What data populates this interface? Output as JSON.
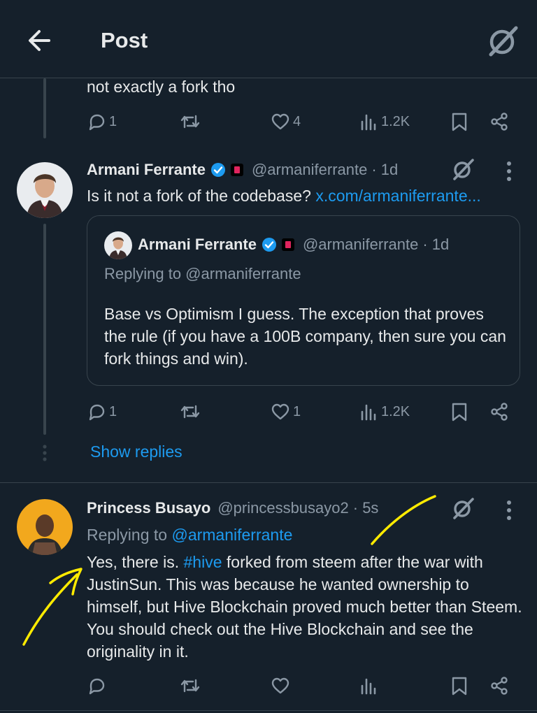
{
  "header": {
    "title": "Post"
  },
  "prev_tweet": {
    "text": "not exactly a fork tho",
    "replies": "1",
    "likes": "4",
    "views": "1.2K"
  },
  "reply1": {
    "name": "Armani Ferrante",
    "handle": "@armaniferrante",
    "time": "· 1d",
    "text": "Is it not a fork of the codebase? ",
    "link": "x.com/armaniferrante...",
    "replies": "1",
    "likes": "1",
    "views": "1.2K",
    "quote": {
      "name": "Armani Ferrante",
      "handle": "@armaniferrante",
      "time": "· 1d",
      "replying_prefix": "Replying to @armaniferrante",
      "text": "Base vs Optimism I guess. The exception that proves the rule (if you have a 100B company, then sure you can fork things and win)."
    }
  },
  "show_replies": "Show replies",
  "reply2": {
    "name": "Princess Busayo",
    "handle": "@princessbusayo2",
    "time": "· 5s",
    "replying_prefix": "Replying to ",
    "replying_handle": "@armaniferrante",
    "text_before": "Yes, there is. ",
    "hashtag": "#hive",
    "text_after": " forked from steem after the war with JustinSun. This was because he wanted ownership to himself, but Hive Blockchain proved much better than Steem. You should check out the Hive Blockchain and see the originality in it."
  },
  "colors": {
    "background": "#15202b",
    "accent": "#1d9bf0",
    "muted": "#8b98a5",
    "annotation": "#ffeb00"
  },
  "icons": [
    "back-arrow-icon",
    "grok-icon",
    "reply-icon",
    "retweet-icon",
    "like-icon",
    "views-icon",
    "bookmark-icon",
    "share-icon",
    "more-icon",
    "verified-badge-icon"
  ]
}
